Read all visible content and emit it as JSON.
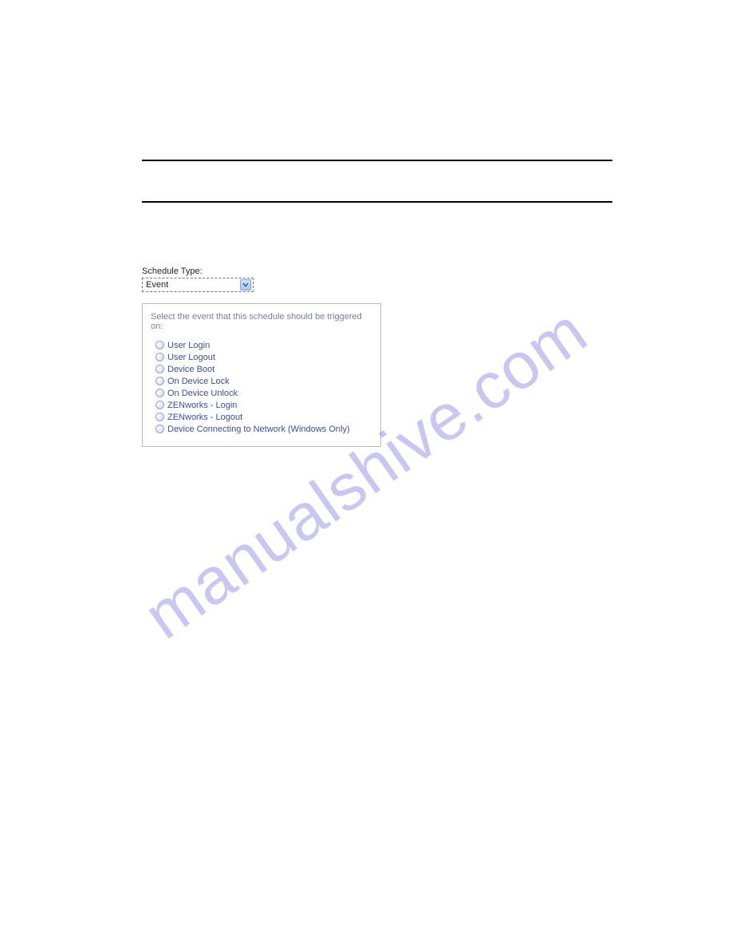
{
  "watermark": "manualshive.com",
  "schedule": {
    "label": "Schedule Type:",
    "selected": "Event",
    "panelTitle": "Select the event that this schedule should be triggered on:",
    "options": [
      "User Login",
      "User Logout",
      "Device Boot",
      "On Device Lock",
      "On Device Unlock",
      "ZENworks - Login",
      "ZENworks - Logout",
      "Device Connecting to Network (Windows Only)"
    ]
  }
}
